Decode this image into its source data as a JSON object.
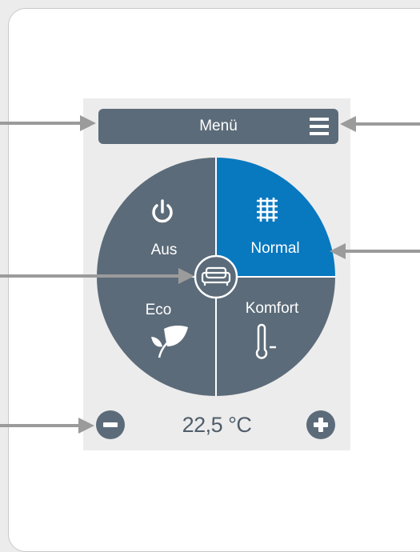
{
  "header": {
    "menu_label": "Menü",
    "menu_icon": "hamburger-menu-icon"
  },
  "modes": {
    "off_label": "Aus",
    "normal_label": "Normal",
    "eco_label": "Eco",
    "comfort_label": "Komfort",
    "active": "Normal",
    "center_icon": "sofa-icon"
  },
  "temperature": {
    "value": "22,5 °C",
    "decrease_icon": "minus-icon",
    "increase_icon": "plus-icon"
  },
  "colors": {
    "segment": "#5c6b79",
    "active_segment": "#0878bf",
    "panel": "#ececec",
    "arrow": "#9b9b9b"
  }
}
